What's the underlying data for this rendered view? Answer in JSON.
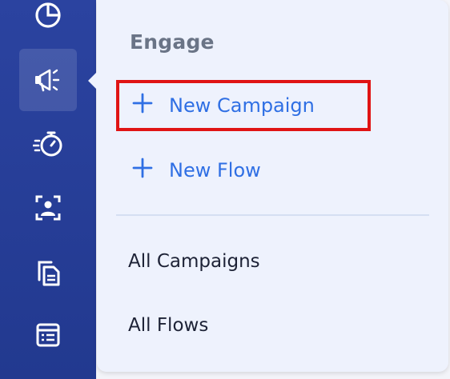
{
  "sidebar": {
    "items": [
      {
        "icon": "pie-chart-icon",
        "active": false
      },
      {
        "icon": "megaphone-icon",
        "active": true
      },
      {
        "icon": "stopwatch-icon",
        "active": false
      },
      {
        "icon": "contact-card-icon",
        "active": false
      },
      {
        "icon": "copy-document-icon",
        "active": false
      },
      {
        "icon": "table-icon",
        "active": false
      }
    ]
  },
  "menu": {
    "title": "Engage",
    "actions": [
      {
        "label": "New Campaign",
        "icon": "plus-icon"
      },
      {
        "label": "New Flow",
        "icon": "plus-icon"
      }
    ],
    "links": [
      {
        "label": "All Campaigns"
      },
      {
        "label": "All Flows"
      }
    ]
  },
  "colors": {
    "sidebar": "#2b43a0",
    "panel": "#eef2fd",
    "accent": "#2f6fe4",
    "highlight": "#e01414",
    "title": "#6a7486"
  }
}
